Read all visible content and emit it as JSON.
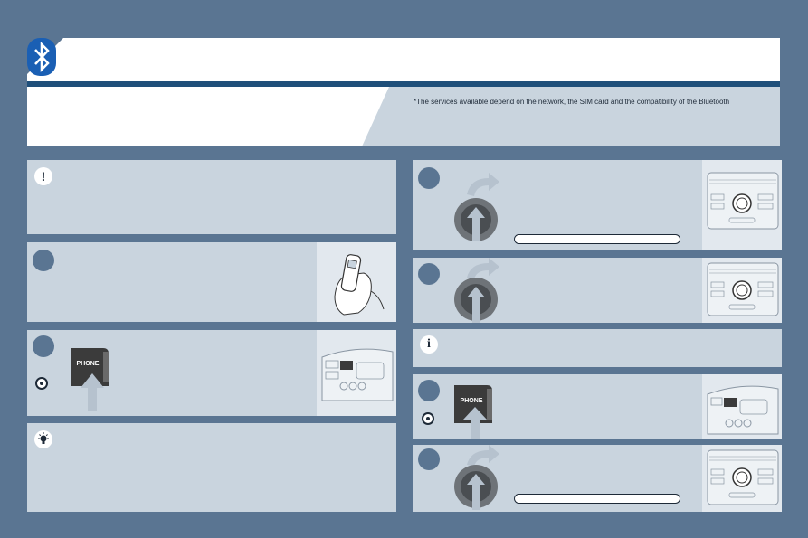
{
  "header": {
    "footnote": "*The services available depend on the network, the SIM card and the compatibility of the Bluetooth"
  },
  "phone_key_label": "PHONE",
  "icons": {
    "bluetooth": "bluetooth-icon",
    "warning": "!",
    "info": "i",
    "tip": "lightbulb-icon"
  },
  "colors": {
    "background": "#5a7592",
    "panel": "#c9d4de",
    "band": "#1f4f7a"
  }
}
